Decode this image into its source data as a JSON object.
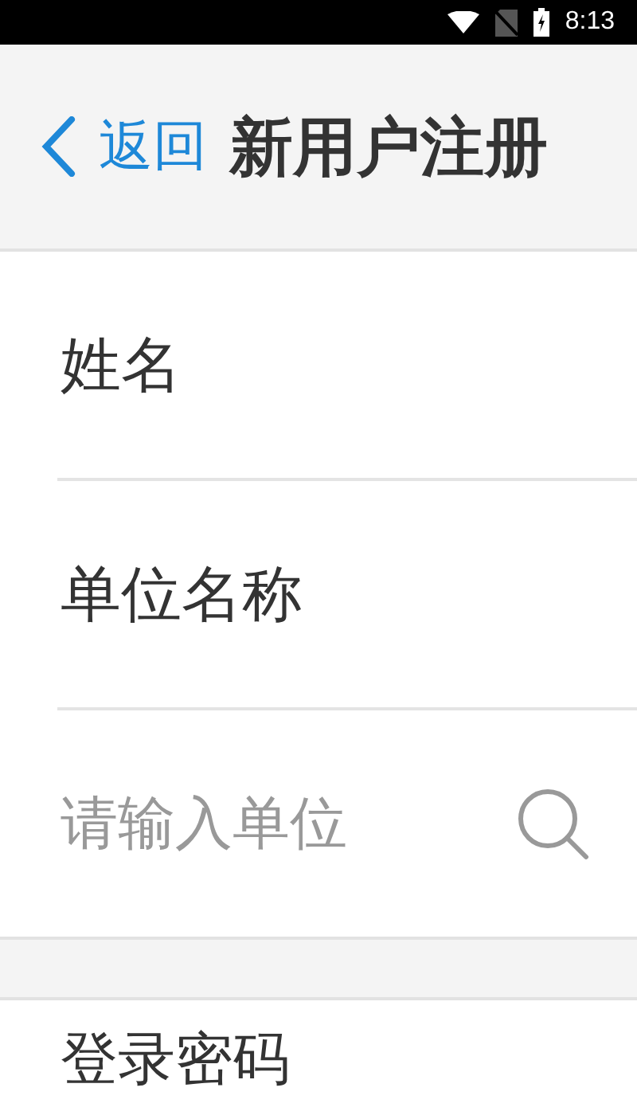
{
  "status_bar": {
    "time": "8:13"
  },
  "header": {
    "back_label": "返回",
    "title": "新用户注册"
  },
  "rows": [
    {
      "kind": "label",
      "text": "姓名"
    },
    {
      "kind": "label",
      "text": "单位名称"
    },
    {
      "kind": "search",
      "placeholder": "请输入单位"
    }
  ],
  "next_section": {
    "label": "登录密码"
  }
}
